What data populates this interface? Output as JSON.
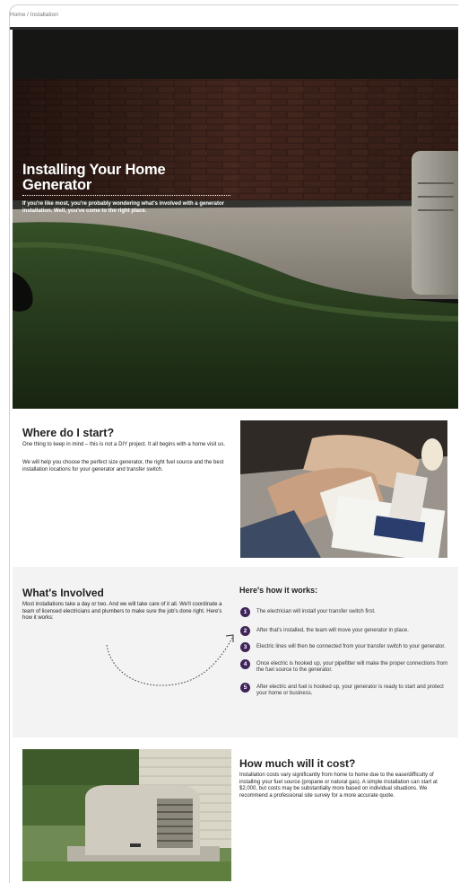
{
  "breadcrumb": {
    "home": "Home",
    "separator": " / ",
    "current": "Installation"
  },
  "hero": {
    "title": "Installing Your Home Generator",
    "subtitle": "If you're like most, you're probably wondering what's involved with a generator installation. Well, you've come to the right place."
  },
  "where": {
    "heading": "Where do I start?",
    "p1": "One thing to keep in mind – this is not a DIY project. It all begins with a home visit us.",
    "p2": "We will help you choose the perfect size generator, the right fuel source and the best installation locations for your generator and transfer switch."
  },
  "involved": {
    "heading": "What's Involved",
    "description": "Most installations take a day or two. And we will take care of it all. We'll coordinate a team of licensed electricians and plumbers to make sure the job's done right. Here's how it works:",
    "steps_title": "Here's how it works:",
    "steps": [
      {
        "num": "1",
        "text": "The electrician will install your transfer switch first."
      },
      {
        "num": "2",
        "text": "After that's installed, the team will move your generator in place."
      },
      {
        "num": "3",
        "text": "Electric lines will then be connected from your transfer switch to your generator."
      },
      {
        "num": "4",
        "text": "Once electric is hooked up, your pipefitter will make the proper connections from the fuel source to the generator."
      },
      {
        "num": "5",
        "text": "After electric and fuel is hooked up, your generator is ready to start and protect your home or business."
      }
    ]
  },
  "cost": {
    "heading": "How much will it cost?",
    "text": "Installation costs vary significantly from home to home due to the ease/difficulty of installing your fuel source (propane or natural gas). A simple installation can start at $2,000, but costs may be substantially more based on individual situations. We recommend a professional site survey for a more accurate quote."
  },
  "colors": {
    "accent": "#3f2459",
    "panel": "#f3f3f3",
    "hero_dark": "#151513"
  }
}
